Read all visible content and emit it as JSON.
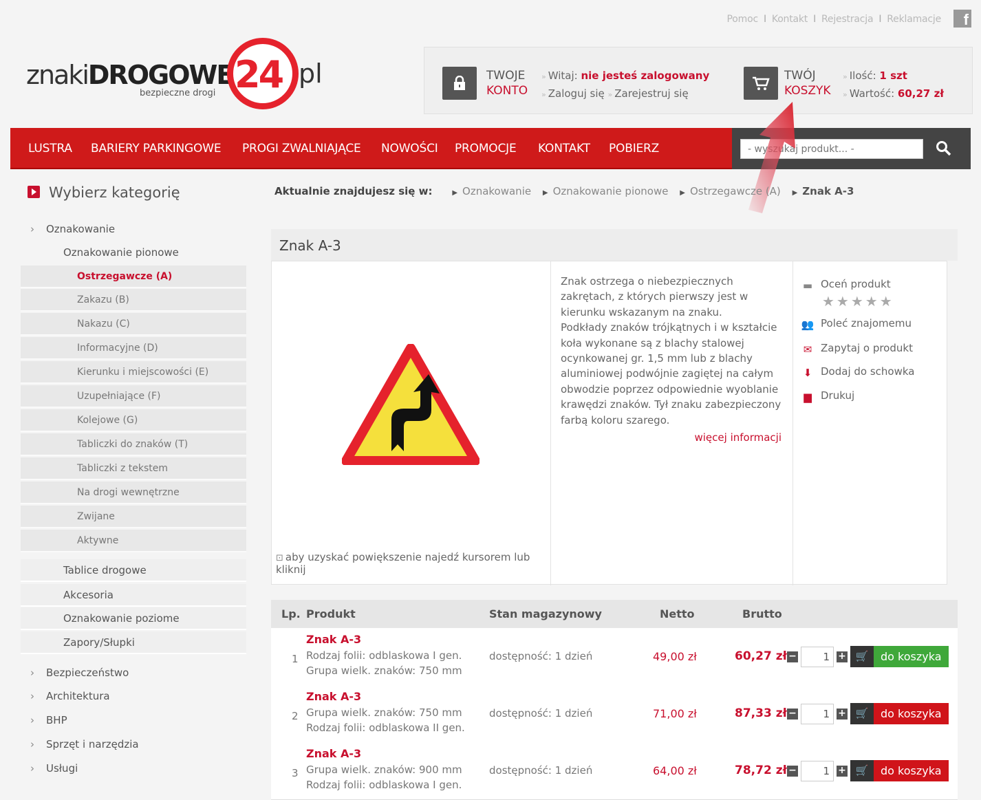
{
  "toplinks": [
    "Pomoc",
    "Kontakt",
    "Rejestracja",
    "Reklamacje"
  ],
  "fb": "f",
  "logo": {
    "part1": "znaki",
    "part2": "DROGOWE",
    "num": "24",
    "suffix": "pl",
    "tagline": "bezpieczne drogi"
  },
  "account": {
    "line1": "TWOJE",
    "line2": "KONTO",
    "welcome": "Witaj:",
    "status": "nie jesteś zalogowany",
    "login": "Zaloguj się",
    "register": "Zarejestruj się"
  },
  "cart": {
    "line1": "TWÓJ",
    "line2": "KOSZYK",
    "qty_label": "Ilość:",
    "qty": "1 szt",
    "value_label": "Wartość:",
    "value": "60,27 zł"
  },
  "nav": [
    "LUSTRA",
    "BARIERY PARKINGOWE",
    "PROGI ZWALNIAJĄCE",
    "NOWOŚCI",
    "PROMOCJE",
    "KONTAKT",
    "POBIERZ"
  ],
  "search": {
    "placeholder": "- wyszukaj produkt... -"
  },
  "sidebar": {
    "title": "Wybierz kategorię",
    "items": [
      {
        "label": "Oznakowanie",
        "level": 0
      },
      {
        "label": "Oznakowanie pionowe",
        "level": 1
      },
      {
        "label": "Ostrzegawcze (A)",
        "level": 2,
        "selected": true
      },
      {
        "label": "Zakazu (B)",
        "level": 2
      },
      {
        "label": "Nakazu (C)",
        "level": 2
      },
      {
        "label": "Informacyjne (D)",
        "level": 2
      },
      {
        "label": "Kierunku i miejscowości (E)",
        "level": 2
      },
      {
        "label": "Uzupełniające (F)",
        "level": 2
      },
      {
        "label": "Kolejowe (G)",
        "level": 2
      },
      {
        "label": "Tabliczki do znaków (T)",
        "level": 2
      },
      {
        "label": "Tabliczki z tekstem",
        "level": 2
      },
      {
        "label": "Na drogi wewnętrzne",
        "level": 2
      },
      {
        "label": "Zwijane",
        "level": 2
      },
      {
        "label": "Aktywne",
        "level": 2
      },
      {
        "label": "Tablice drogowe",
        "level": 1
      },
      {
        "label": "Akcesoria",
        "level": 1
      },
      {
        "label": "Oznakowanie poziome",
        "level": 1
      },
      {
        "label": "Zapory/Słupki",
        "level": 1
      },
      {
        "label": "Bezpieczeństwo",
        "level": 0
      },
      {
        "label": "Architektura",
        "level": 0
      },
      {
        "label": "BHP",
        "level": 0
      },
      {
        "label": "Sprzęt i narzędzia",
        "level": 0
      },
      {
        "label": "Usługi",
        "level": 0
      }
    ]
  },
  "breadcrumb": {
    "label": "Aktualnie znajdujesz się w:",
    "items": [
      "Oznakowanie",
      "Oznakowanie pionowe",
      "Ostrzegawcze (A)"
    ],
    "current": "Znak A-3"
  },
  "product": {
    "title": "Znak A-3",
    "description": "Znak ostrzega o niebezpiecznych zakrętach, z których pierwszy jest w kierunku wskazanym na znaku.\nPodkłady znaków trójkątnych i w kształcie koła wykonane są z blachy stalowej ocynkowanej gr. 1,5 mm lub z blachy aluminiowej podwójnie zagiętej na całym obwodzie poprzez odpowiednie wyoblanie krawędzi znaków. Tył znaku zabezpieczony farbą koloru szarego.",
    "more": "więcej informacji",
    "zoom_tip": "aby uzyskać powiększenie najedź kursorem lub kliknij",
    "actions": [
      "Oceń produkt",
      "Poleć znajomemu",
      "Zapytaj o produkt",
      "Dodaj do schowka",
      "Drukuj"
    ],
    "stars": "★★★★★"
  },
  "table": {
    "headers": [
      "Lp.",
      "Produkt",
      "Stan magazynowy",
      "Netto",
      "Brutto"
    ],
    "rows": [
      {
        "lp": "1",
        "name": "Znak A-3",
        "d1": "Rodzaj folii: odblaskowa I gen.",
        "d2": "Grupa wielk. znaków: 750 mm",
        "stock": "dostępność: 1 dzień",
        "netto": "49,00 zł",
        "brutto": "60,27 zł",
        "qty": "1",
        "btn": "do koszyka",
        "color": "#3fa83a"
      },
      {
        "lp": "2",
        "name": "Znak A-3",
        "d1": "Grupa wielk. znaków: 750 mm",
        "d2": "Rodzaj folii: odblaskowa II gen.",
        "stock": "dostępność: 1 dzień",
        "netto": "71,00 zł",
        "brutto": "87,33 zł",
        "qty": "1",
        "btn": "do koszyka",
        "color": "#d0141a"
      },
      {
        "lp": "3",
        "name": "Znak A-3",
        "d1": "Grupa wielk. znaków: 900 mm",
        "d2": "Rodzaj folii: odblaskowa I gen.",
        "stock": "dostępność: 1 dzień",
        "netto": "64,00 zł",
        "brutto": "78,72 zł",
        "qty": "1",
        "btn": "do koszyka",
        "color": "#d0141a"
      }
    ]
  }
}
